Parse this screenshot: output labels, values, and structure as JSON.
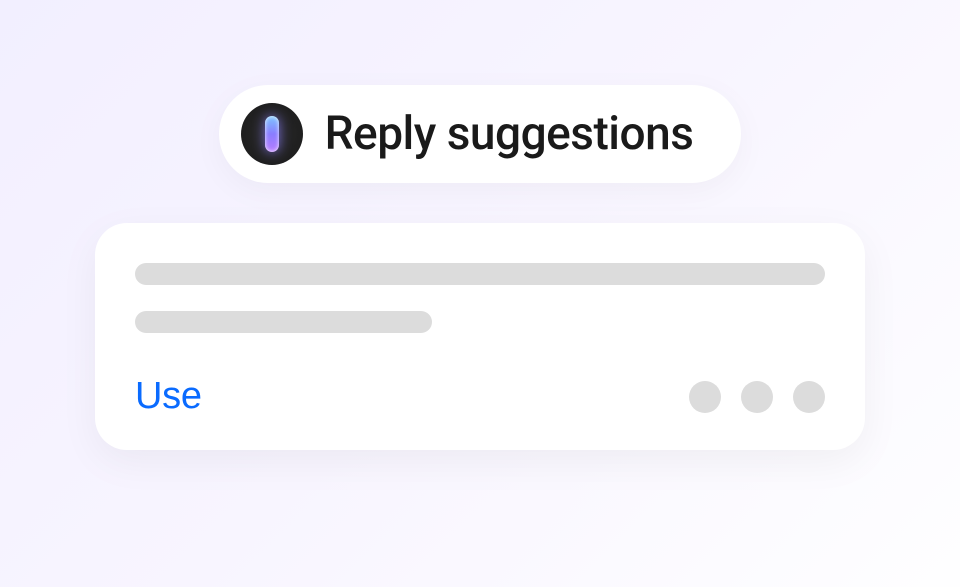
{
  "header": {
    "title": "Reply suggestions",
    "icon_name": "ai-assistant-icon"
  },
  "suggestion": {
    "use_label": "Use",
    "accent_color": "#0a6bff",
    "placeholder_color": "#dcdcdc",
    "dot_count": 3
  }
}
